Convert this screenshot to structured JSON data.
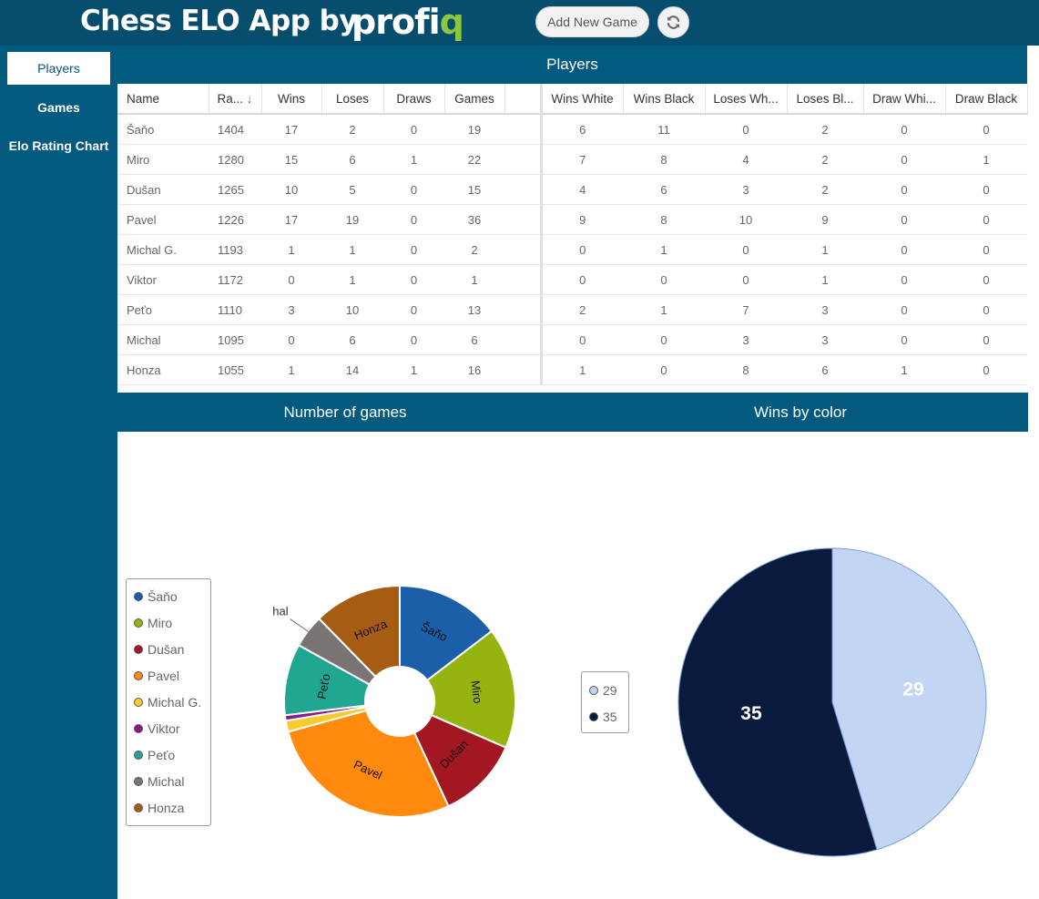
{
  "app": {
    "title": "Chess ELO App by",
    "logo_main": "profi",
    "logo_accent": "q",
    "add_game_label": "Add New Game",
    "refresh_icon": "refresh-icon"
  },
  "sidebar": {
    "items": [
      {
        "label": "Players",
        "active": true
      },
      {
        "label": "Games",
        "active": false
      },
      {
        "label": "Elo Rating Chart",
        "active": false
      }
    ]
  },
  "players_section": {
    "title": "Players",
    "columns": [
      "Name",
      "Ra...",
      "Wins",
      "Loses",
      "Draws",
      "Games",
      "",
      "Wins White",
      "Wins Black",
      "Loses Wh...",
      "Loses Bl...",
      "Draw Whi...",
      "Draw Black"
    ],
    "sort_icon": "arrow-down-icon",
    "rows": [
      [
        "Šaňo",
        "1404",
        "17",
        "2",
        "0",
        "19",
        "",
        "6",
        "11",
        "0",
        "2",
        "0",
        "0"
      ],
      [
        "Miro",
        "1280",
        "15",
        "6",
        "1",
        "22",
        "",
        "7",
        "8",
        "4",
        "2",
        "0",
        "1"
      ],
      [
        "Dušan",
        "1265",
        "10",
        "5",
        "0",
        "15",
        "",
        "4",
        "6",
        "3",
        "2",
        "0",
        "0"
      ],
      [
        "Pavel",
        "1226",
        "17",
        "19",
        "0",
        "36",
        "",
        "9",
        "8",
        "10",
        "9",
        "0",
        "0"
      ],
      [
        "Michal G.",
        "1193",
        "1",
        "1",
        "0",
        "2",
        "",
        "0",
        "1",
        "0",
        "1",
        "0",
        "0"
      ],
      [
        "Viktor",
        "1172",
        "0",
        "1",
        "0",
        "1",
        "",
        "0",
        "0",
        "0",
        "1",
        "0",
        "0"
      ],
      [
        "Peťo",
        "1110",
        "3",
        "10",
        "0",
        "13",
        "",
        "2",
        "1",
        "7",
        "3",
        "0",
        "0"
      ],
      [
        "Michal",
        "1095",
        "0",
        "6",
        "0",
        "6",
        "",
        "0",
        "0",
        "3",
        "3",
        "0",
        "0"
      ],
      [
        "Honza",
        "1055",
        "1",
        "14",
        "1",
        "16",
        "",
        "1",
        "0",
        "8",
        "6",
        "1",
        "0"
      ]
    ]
  },
  "games_chart_title": "Number of games",
  "wins_chart_title": "Wins by color",
  "chart_data": [
    {
      "type": "pie",
      "variant": "donut",
      "categories": [
        "Šaňo",
        "Miro",
        "Dušan",
        "Pavel",
        "Michal G.",
        "Viktor",
        "Peťo",
        "Michal",
        "Honza"
      ],
      "values": [
        19,
        22,
        15,
        36,
        2,
        1,
        13,
        6,
        16
      ],
      "colors": [
        "#1a5fa8",
        "#96b40f",
        "#a31722",
        "#ff8a0e",
        "#f6cb2a",
        "#8b1a8c",
        "#21a694",
        "#7a7474",
        "#a55d14"
      ],
      "slice_labels": [
        "Šaňo",
        "Miro",
        "Dušan",
        "Pavel",
        "",
        "",
        "Peťo",
        "Michal",
        "Honza"
      ],
      "legend": "left"
    },
    {
      "type": "pie",
      "categories": [
        "29",
        "35"
      ],
      "values": [
        29,
        35
      ],
      "colors": [
        "#c2d6f4",
        "#0a1a3d"
      ],
      "slice_labels": [
        "29",
        "35"
      ],
      "legend": "left"
    }
  ]
}
